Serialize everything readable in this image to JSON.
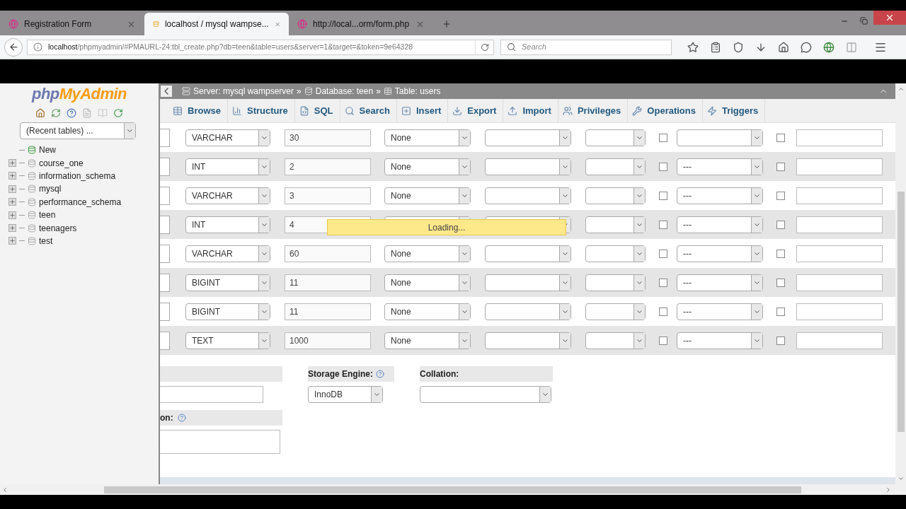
{
  "browser": {
    "tabs": [
      {
        "title": "Registration Form",
        "kind": "form",
        "selected": false
      },
      {
        "title": "localhost / mysql wampse...",
        "kind": "pma",
        "selected": true
      },
      {
        "title": "http://local...orm/form.php",
        "kind": "form",
        "selected": false
      }
    ],
    "url_host": "localhost",
    "url_path": "/phpmyadmin/#PMAURL-24:tbl_create.php?db=teen&table=users&server=1&target=&token=9e64328",
    "search_placeholder": "Search"
  },
  "sidebar": {
    "logo_first": "php",
    "logo_second": "MyAdmin",
    "recent_tables": "(Recent tables) ...",
    "tree": [
      {
        "label": "New",
        "kind": "new"
      },
      {
        "label": "course_one",
        "kind": "db"
      },
      {
        "label": "information_schema",
        "kind": "db"
      },
      {
        "label": "mysql",
        "kind": "db"
      },
      {
        "label": "performance_schema",
        "kind": "db"
      },
      {
        "label": "teen",
        "kind": "db"
      },
      {
        "label": "teenagers",
        "kind": "db"
      },
      {
        "label": "test",
        "kind": "db"
      }
    ]
  },
  "breadcrumb": {
    "separator": "»",
    "items": [
      {
        "label": "Server: mysql wampserver",
        "kind": "server"
      },
      {
        "label": "Database: teen",
        "kind": "database"
      },
      {
        "label": "Table: users",
        "kind": "table"
      }
    ]
  },
  "menu_tabs": [
    {
      "label": "Browse",
      "kind": "browse"
    },
    {
      "label": "Structure",
      "kind": "structure"
    },
    {
      "label": "SQL",
      "kind": "sql"
    },
    {
      "label": "Search",
      "kind": "search"
    },
    {
      "label": "Insert",
      "kind": "insert"
    },
    {
      "label": "Export",
      "kind": "export"
    },
    {
      "label": "Import",
      "kind": "import"
    },
    {
      "label": "Privileges",
      "kind": "privileges"
    },
    {
      "label": "Operations",
      "kind": "operations"
    },
    {
      "label": "Triggers",
      "kind": "triggers"
    }
  ],
  "rows": [
    {
      "type": "VARCHAR",
      "length": "30",
      "default": "None",
      "index": "",
      "null_checked": false,
      "ai_checked": false
    },
    {
      "type": "INT",
      "length": "2",
      "default": "None",
      "index": "---",
      "null_checked": false,
      "ai_checked": false
    },
    {
      "type": "VARCHAR",
      "length": "3",
      "default": "None",
      "index": "---",
      "null_checked": false,
      "ai_checked": false
    },
    {
      "type": "INT",
      "length": "4",
      "default": "",
      "index": "---",
      "null_checked": false,
      "ai_checked": false
    },
    {
      "type": "VARCHAR",
      "length": "60",
      "default": "None",
      "index": "---",
      "null_checked": false,
      "ai_checked": false
    },
    {
      "type": "BIGINT",
      "length": "11",
      "default": "None",
      "index": "---",
      "null_checked": false,
      "ai_checked": false
    },
    {
      "type": "BIGINT",
      "length": "11",
      "default": "None",
      "index": "---",
      "null_checked": false,
      "ai_checked": false
    },
    {
      "type": "TEXT",
      "length": "1000",
      "default": "None",
      "index": "---",
      "null_checked": false,
      "ai_checked": false
    }
  ],
  "loading": "Loading...",
  "table_options": {
    "comment_label": "on:",
    "storage_engine_label": "Storage Engine:",
    "storage_engine": "InnoDB",
    "collation_label": "Collation:"
  }
}
